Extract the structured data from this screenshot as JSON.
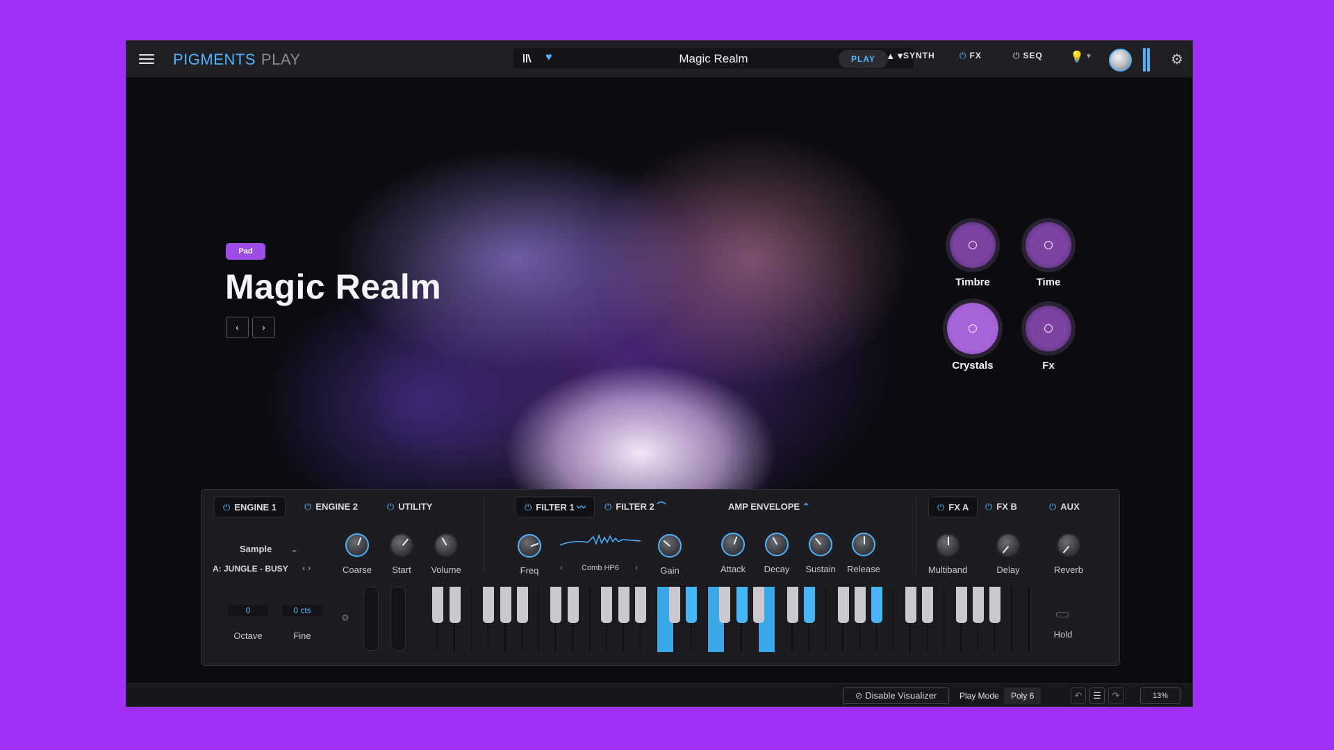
{
  "app": {
    "brand_main": "PIGMENTS",
    "brand_sub": "PLAY"
  },
  "header": {
    "preset_name": "Magic Realm",
    "arrows": "▲▼",
    "tabs": {
      "play": "PLAY",
      "synth": "SYNTH",
      "fx": "FX",
      "seq": "SEQ"
    }
  },
  "preset": {
    "tag": "Pad",
    "title": "Magic Realm",
    "prev": "‹",
    "next": "›"
  },
  "macros": [
    {
      "label": "Timbre"
    },
    {
      "label": "Time"
    },
    {
      "label": "Crystals"
    },
    {
      "label": "Fx"
    }
  ],
  "panel": {
    "tabs": {
      "engine1": "ENGINE 1",
      "engine2": "ENGINE 2",
      "utility": "UTILITY",
      "filter1": "FILTER 1",
      "filter2": "FILTER 2",
      "amp_envelope": "AMP ENVELOPE",
      "fxa": "FX A",
      "fxb": "FX B",
      "aux": "AUX"
    },
    "engine": {
      "type": "Sample",
      "sample": "A: JUNGLE - BUSY",
      "coarse": "Coarse",
      "start": "Start",
      "volume": "Volume",
      "octave_value": "0",
      "octave_label": "Octave",
      "fine_value": "0 cts",
      "fine_label": "Fine"
    },
    "filter": {
      "freq": "Freq",
      "type": "Comb HP6",
      "gain": "Gain"
    },
    "envelope": {
      "attack": "Attack",
      "decay": "Decay",
      "sustain": "Sustain",
      "release": "Release"
    },
    "fx": {
      "multiband": "Multiband",
      "delay": "Delay",
      "reverb": "Reverb"
    },
    "hold": "Hold"
  },
  "statusbar": {
    "disable_visualizer": "Disable Visualizer",
    "play_mode_label": "Play Mode",
    "play_mode_value": "Poly 6",
    "cpu": "13%"
  },
  "colors": {
    "accent": "#4fb4ff",
    "macro": "#9b4de6",
    "background": "#a130f9"
  }
}
